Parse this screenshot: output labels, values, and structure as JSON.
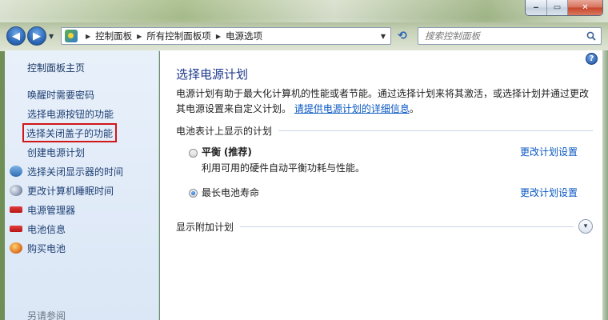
{
  "window": {
    "minimize_glyph": "‒",
    "maximize_glyph": "▭",
    "close_glyph": "✕"
  },
  "nav": {
    "back_glyph": "◀",
    "forward_glyph": "▶",
    "breadcrumb": [
      "控制面板",
      "所有控制面板项",
      "电源选项"
    ],
    "refresh_glyph": "⟲",
    "search_placeholder": "搜索控制面板"
  },
  "sidebar": {
    "home": "控制面板主页",
    "tasks": [
      {
        "label": "唤醒时需要密码",
        "icon": ""
      },
      {
        "label": "选择电源按钮的功能",
        "icon": ""
      },
      {
        "label": "选择关闭盖子的功能",
        "icon": "",
        "highlighted": true
      },
      {
        "label": "创建电源计划",
        "icon": ""
      },
      {
        "label": "选择关闭显示器的时间",
        "icon": "monitor-icon"
      },
      {
        "label": "更改计算机睡眠时间",
        "icon": "moon-icon"
      },
      {
        "label": "电源管理器",
        "icon": "battery-icon"
      },
      {
        "label": "电池信息",
        "icon": "battery-icon"
      },
      {
        "label": "购买电池",
        "icon": "globe-icon"
      }
    ],
    "see_also": "另请参阅"
  },
  "main": {
    "title": "选择电源计划",
    "description": "电源计划有助于最大化计算机的性能或者节能。通过选择计划来将其激活，或选择计划并通过更改其电源设置来自定义计划。",
    "description_link": "请提供电源计划的详细信息",
    "description_end": "。",
    "section_battery": "电池表计上显示的计划",
    "plans": [
      {
        "name": "平衡",
        "suffix": "(推荐)",
        "description": "利用可用的硬件自动平衡功耗与性能。",
        "selected": false,
        "link": "更改计划设置"
      },
      {
        "name": "最长电池寿命",
        "suffix": "",
        "description": "",
        "selected": true,
        "link": "更改计划设置"
      }
    ],
    "section_additional": "显示附加计划",
    "help_glyph": "?",
    "expand_glyph": "▾"
  },
  "colors": {
    "link": "#0a58c2",
    "title": "#1e3a8c",
    "highlight_box": "#d01818",
    "sidebar_bg": "#dbe7f6"
  }
}
